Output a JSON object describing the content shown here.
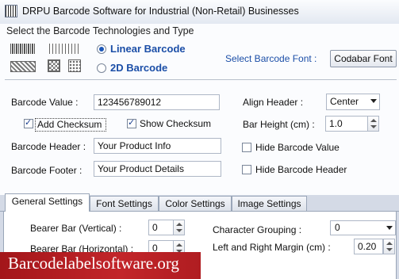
{
  "window": {
    "title": "DRPU Barcode Software for Industrial (Non-Retail) Businesses"
  },
  "technology": {
    "section_title": "Select the Barcode Technologies and Type",
    "options": [
      {
        "label": "Linear Barcode",
        "selected": true
      },
      {
        "label": "2D Barcode",
        "selected": false
      }
    ],
    "font_label": "Select Barcode Font :",
    "font_value": "Codabar Font"
  },
  "form": {
    "barcode_value_label": "Barcode Value :",
    "barcode_value": "123456789012",
    "add_checksum_label": "Add Checksum",
    "add_checksum": true,
    "show_checksum_label": "Show Checksum",
    "show_checksum": true,
    "header_label": "Barcode Header :",
    "header_value": "Your Product Info",
    "footer_label": "Barcode Footer :",
    "footer_value": "Your Product Details",
    "align_header_label": "Align Header :",
    "align_header_value": "Center",
    "bar_height_label": "Bar Height (cm) :",
    "bar_height_value": "1.0",
    "hide_value_label": "Hide Barcode Value",
    "hide_value": false,
    "hide_header_label": "Hide Barcode Header",
    "hide_header": false
  },
  "tabs": [
    {
      "label": "General Settings",
      "active": true
    },
    {
      "label": "Font Settings",
      "active": false
    },
    {
      "label": "Color Settings",
      "active": false
    },
    {
      "label": "Image Settings",
      "active": false
    }
  ],
  "general": {
    "bearer_vertical_label": "Bearer Bar (Vertical) :",
    "bearer_vertical_value": "0",
    "bearer_horizontal_label": "Bearer Bar (Horizontal) :",
    "bearer_horizontal_value": "0",
    "char_grouping_label": "Character Grouping :",
    "char_grouping_value": "0",
    "margin_label": "Left and Right Margin (cm) :",
    "margin_value": "0.20"
  },
  "banner": {
    "text": "Barcodelabelsoftware.org"
  },
  "colors": {
    "accent": "#1b4ea7",
    "banner": "#b01d21",
    "background": "#d4dae6"
  }
}
